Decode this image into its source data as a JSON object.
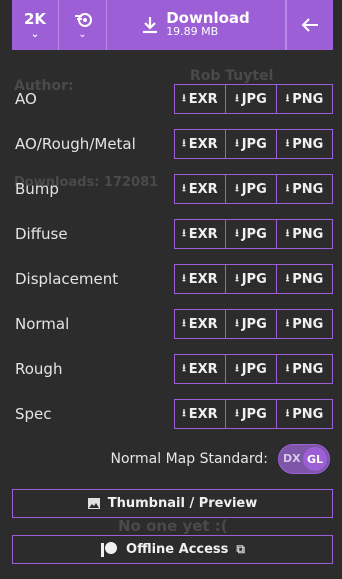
{
  "topbar": {
    "resolution": "2K",
    "download_label": "Download",
    "download_size": "19.89 MB"
  },
  "background": {
    "author_label": "Author:",
    "author_name": "Rob Tuytel",
    "downloads_label": "Downloads: 172081",
    "no_one": "No one yet :("
  },
  "maps": [
    {
      "label": "AO"
    },
    {
      "label": "AO/Rough/Metal"
    },
    {
      "label": "Bump"
    },
    {
      "label": "Diffuse"
    },
    {
      "label": "Displacement"
    },
    {
      "label": "Normal"
    },
    {
      "label": "Rough"
    },
    {
      "label": "Spec"
    }
  ],
  "formats": [
    "EXR",
    "JPG",
    "PNG"
  ],
  "normal_map": {
    "label": "Normal Map Standard:",
    "off_option": "DX",
    "on_option": "GL"
  },
  "buttons": {
    "thumbnail": "Thumbnail / Preview",
    "offline": "Offline Access"
  },
  "colors": {
    "accent": "#9c5fd6",
    "background": "#2c2c2c"
  }
}
